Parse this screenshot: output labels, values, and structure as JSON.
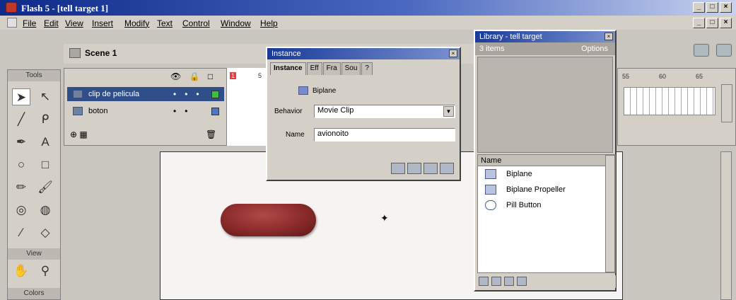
{
  "window": {
    "title": "Flash 5 - [tell target 1]",
    "controls": [
      "_",
      "□",
      "×"
    ]
  },
  "menubar": {
    "items": [
      "File",
      "Edit",
      "View",
      "Insert",
      "Modify",
      "Text",
      "Control",
      "Window",
      "Help"
    ],
    "controls": [
      "_",
      "□",
      "×"
    ]
  },
  "scene": {
    "label": "Scene 1"
  },
  "tools": {
    "header": "Tools",
    "view_header": "View",
    "colors_header": "Colors"
  },
  "timeline": {
    "layers": [
      {
        "name": "clip de pelicula",
        "selected": true,
        "color": "#3fbf3f"
      },
      {
        "name": "boton",
        "selected": false,
        "color": "#4a78c8"
      }
    ],
    "ruler": [
      "1",
      "5"
    ],
    "ruler_right": [
      "55",
      "60",
      "65"
    ]
  },
  "instance_panel": {
    "title": "Instance",
    "tabs": [
      "Instance",
      "Eff",
      "Fra",
      "Sou",
      "?"
    ],
    "symbol_name": "Biplane",
    "behavior_label": "Behavior",
    "behavior_value": "Movie Clip",
    "name_label": "Name",
    "name_value": "avionoito"
  },
  "library_panel": {
    "title": "Library - tell target",
    "count": "3 items",
    "options": "Options",
    "column": "Name",
    "items": [
      "Biplane",
      "Biplane Propeller",
      "Pill Button"
    ]
  },
  "colors": {
    "accent": "#2f4e8a",
    "pill": "#8a2a2a"
  }
}
